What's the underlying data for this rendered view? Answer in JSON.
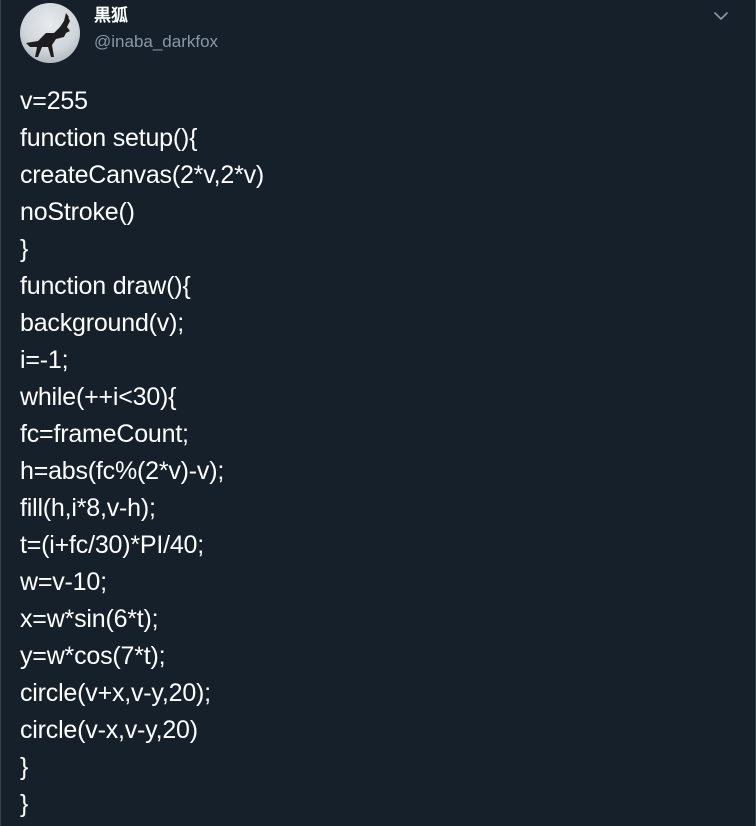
{
  "tweet": {
    "display_name": "黒狐",
    "handle": "@inaba_darkfox",
    "icons": {
      "avatar": "avatar-image",
      "menu": "chevron-down-icon"
    },
    "colors": {
      "background": "#15202b",
      "text": "#ffffff",
      "secondary": "#8899a6"
    },
    "code_lines": [
      "v=255",
      "function setup(){",
      "createCanvas(2*v,2*v)",
      "noStroke()",
      "}",
      "function draw(){",
      "background(v);",
      "i=-1;",
      "while(++i<30){",
      "fc=frameCount;",
      "h=abs(fc%(2*v)-v);",
      "fill(h,i*8,v-h);",
      "t=(i+fc/30)*PI/40;",
      "w=v-10;",
      "x=w*sin(6*t);",
      "y=w*cos(7*t);",
      "circle(v+x,v-y,20);",
      "circle(v-x,v-y,20)",
      "}",
      "}"
    ]
  }
}
